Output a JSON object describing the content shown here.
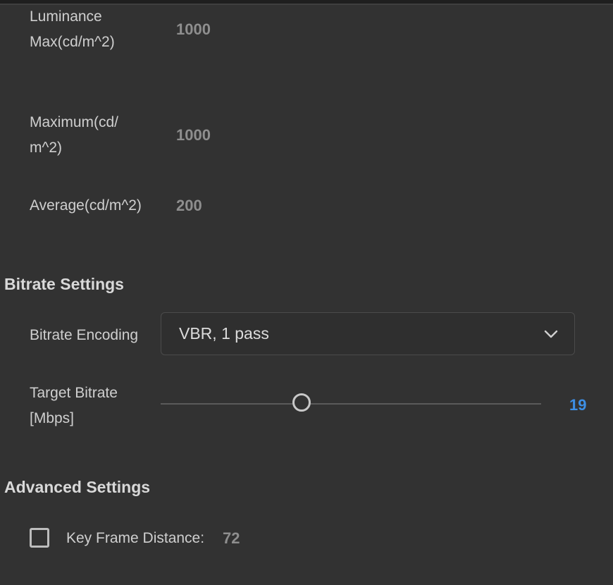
{
  "hdr": {
    "luminance_max_label_line1": "Luminance",
    "luminance_max_label_line2": "Max(cd/m^2)",
    "luminance_max_value": "1000",
    "maximum_label_line1": "Maximum(cd/",
    "maximum_label_line2": "m^2)",
    "maximum_value": "1000",
    "average_label": "Average(cd/m^2)",
    "average_value": "200"
  },
  "bitrate_settings": {
    "title": "Bitrate Settings",
    "encoding_label": "Bitrate Encoding",
    "encoding_value": "VBR, 1 pass",
    "target_label_line1": "Target Bitrate",
    "target_label_line2": "[Mbps]",
    "target_value": "19",
    "target_slider_fraction": 0.37
  },
  "advanced_settings": {
    "title": "Advanced Settings",
    "key_frame_label": "Key Frame Distance:",
    "key_frame_value": "72",
    "key_frame_checked": false
  },
  "colors": {
    "background": "#323232",
    "accent_value": "#3d8fe5"
  },
  "icons": {
    "dropdown": "chevron-down-icon"
  }
}
